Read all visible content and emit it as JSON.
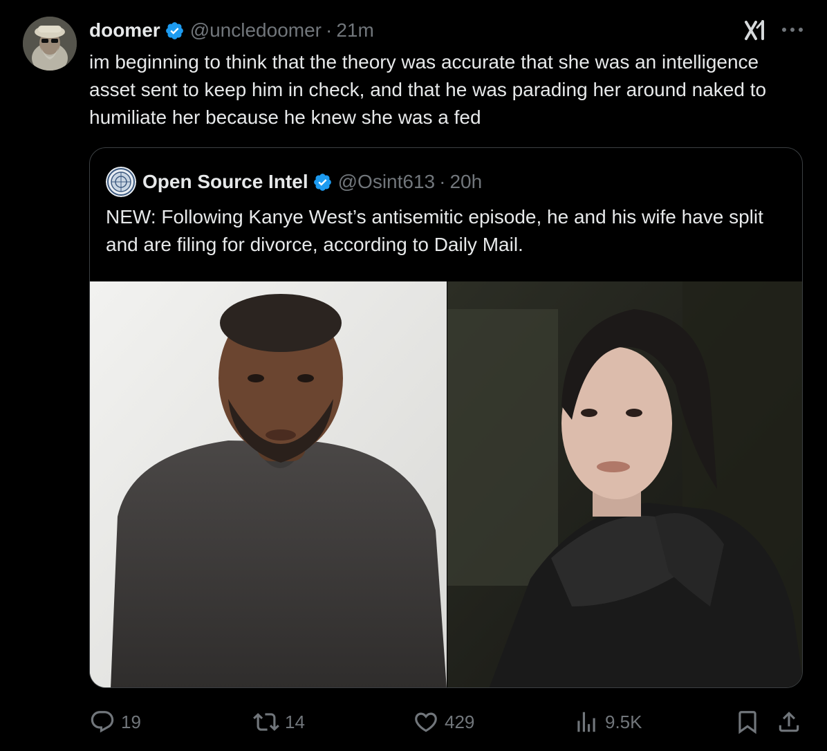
{
  "author": {
    "name": "doomer",
    "handle": "@uncledoomer",
    "time": "21m"
  },
  "tweet_text": "im beginning to think that the theory was accurate that she was an intelligence asset sent to keep him in check, and that he was parading her around naked to humiliate her because he knew she was a fed",
  "quoted": {
    "name": "Open Source Intel",
    "handle": "@Osint613",
    "time": "20h",
    "text": "NEW: Following Kanye West’s antisemitic episode, he and his wife have split and are filing for divorce, according to Daily Mail."
  },
  "separator": "·",
  "actions": {
    "replies": "19",
    "reposts": "14",
    "likes": "429",
    "views": "9.5K"
  },
  "icons": {
    "verified": "verified-badge-icon",
    "grok": "grok-icon",
    "more": "more-icon",
    "reply": "reply-icon",
    "repost": "repost-icon",
    "like": "heart-icon",
    "views": "views-icon",
    "bookmark": "bookmark-icon",
    "share": "share-icon"
  },
  "colors": {
    "background": "#000000",
    "text": "#e7e9ea",
    "muted": "#71767b",
    "verified": "#1d9bf0",
    "border": "#3c4043"
  }
}
